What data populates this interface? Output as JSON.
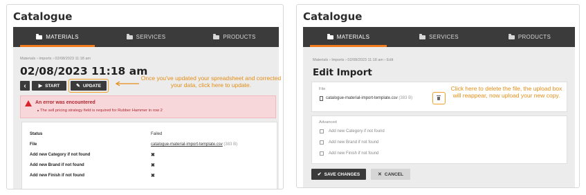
{
  "left": {
    "title": "Catalogue",
    "tabs": [
      {
        "label": "MATERIALS",
        "active": true
      },
      {
        "label": "SERVICES",
        "active": false
      },
      {
        "label": "PRODUCTS",
        "active": false
      }
    ],
    "breadcrumb": "Materials  ›  Imports  ›  02/08/2023 11:18 am",
    "heading": "02/08/2023 11:18 am",
    "back_label": "‹",
    "start_label": "START",
    "update_label": "UPDATE",
    "annotation": "Once you've updated your spreadsheet and corrected your data, click here to update.",
    "alert_title": "An error was encountered",
    "alert_message": "The sell pricing strategy field is required for Rubber Hammer in row 2",
    "details": [
      {
        "label": "Status",
        "value": "Failed"
      },
      {
        "label": "File",
        "value": "catalogue-material-import-template.csv",
        "extra": "(383 B)"
      },
      {
        "label": "Add new Category if not found",
        "value": "✖"
      },
      {
        "label": "Add new Brand if not found",
        "value": "✖"
      },
      {
        "label": "Add new Finish if not found",
        "value": "✖"
      }
    ]
  },
  "right": {
    "title": "Catalogue",
    "tabs": [
      {
        "label": "MATERIALS",
        "active": true
      },
      {
        "label": "SERVICES",
        "active": false
      },
      {
        "label": "PRODUCTS",
        "active": false
      }
    ],
    "breadcrumb": "Materials  ›  Imports  ›  02/08/2023 11:18 am  ›  Edit",
    "heading": "Edit Import",
    "file_label": "File",
    "file_name": "catalogue-material-import-template.csv",
    "file_size": "(383 B)",
    "annotation": "Click here to delete the file, the upload box will reappear, now upload your new copy.",
    "advanced_label": "Advanced",
    "options": [
      "Add new Category if not found",
      "Add new Brand if not found",
      "Add new Finish if not found"
    ],
    "save_label": "SAVE CHANGES",
    "cancel_label": "CANCEL"
  },
  "colors": {
    "accent": "#f07c1e",
    "tabbar": "#3b3b3b",
    "annotation": "#e48d16",
    "alert_bg": "#f8d7da",
    "alert_text": "#b0262f"
  }
}
